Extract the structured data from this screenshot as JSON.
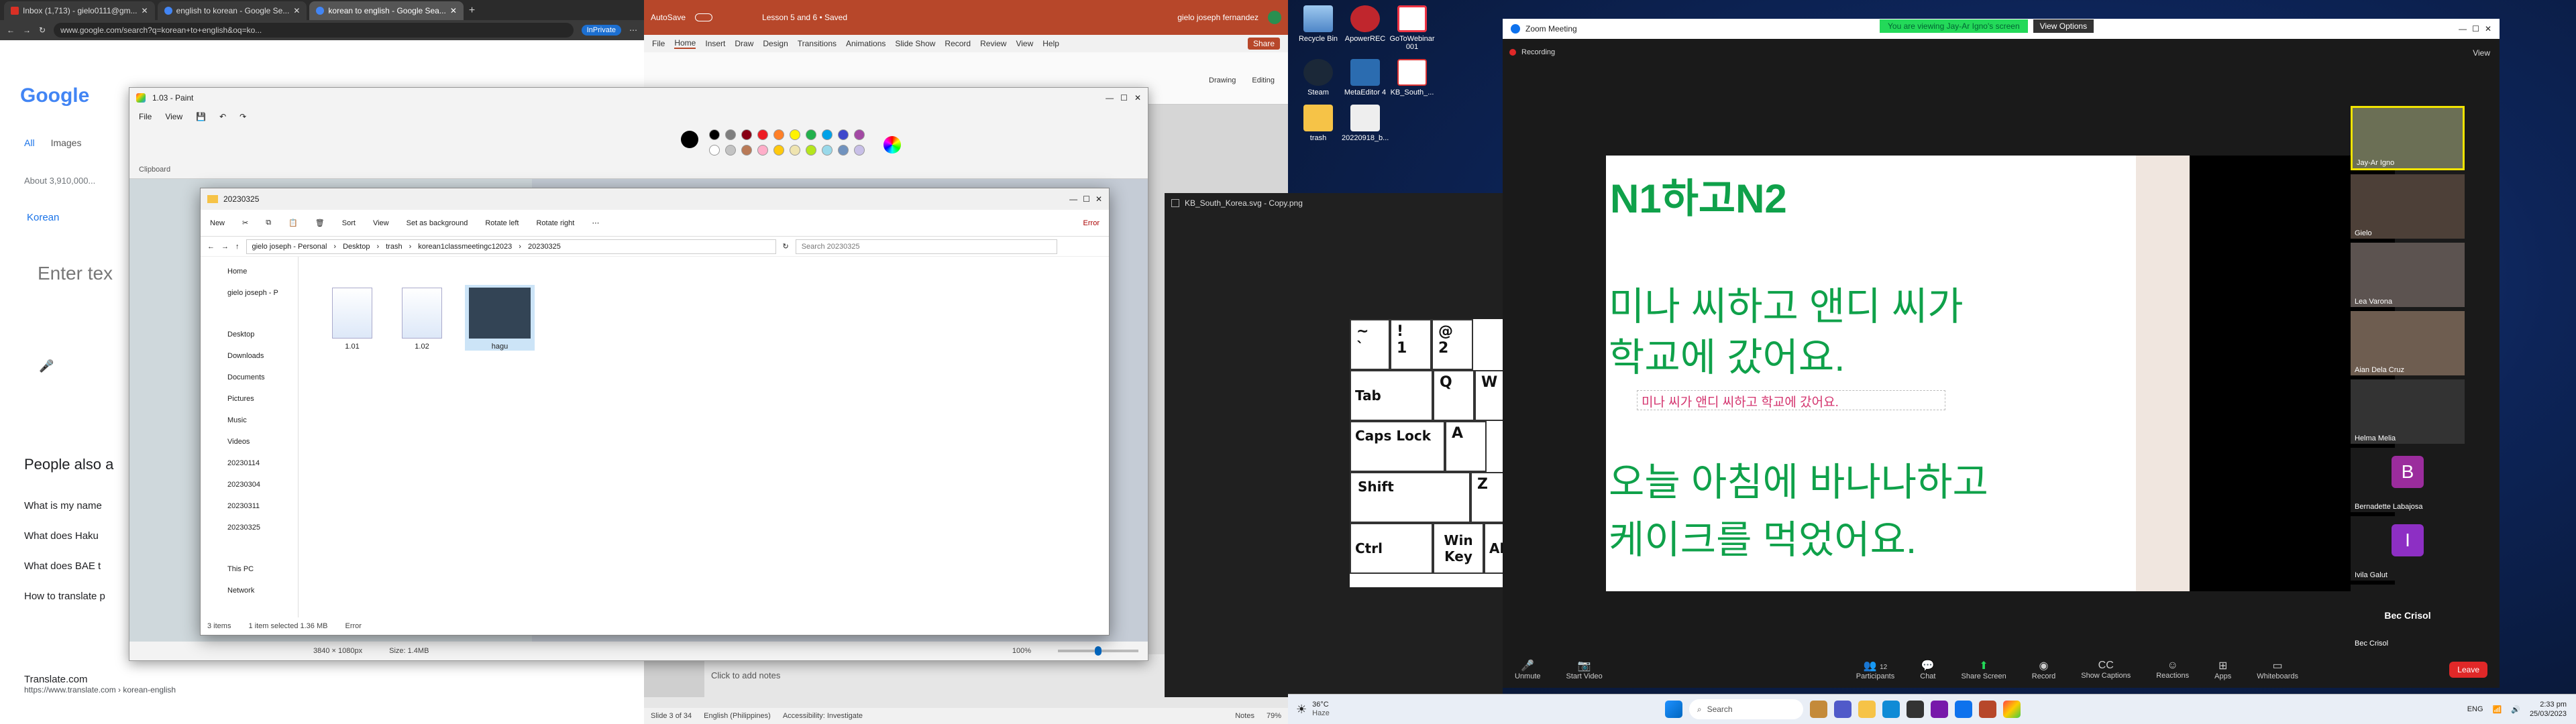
{
  "chrome": {
    "tabs": [
      {
        "label": "Inbox (1,713) - gielo0111@gm..."
      },
      {
        "label": "english to korean - Google Se..."
      },
      {
        "label": "korean to english - Google Sea..."
      }
    ],
    "url": "www.google.com/search?q=korean+to+english&oq=ko...",
    "private_label": "InPrivate",
    "logo": "Google",
    "search_tabs": [
      "All",
      "Images"
    ],
    "results_count": "About 3,910,000...",
    "source_lang": "Korean",
    "enter_text": "Enter tex",
    "people_also_ask": "People also a",
    "questions": [
      "What is my name",
      "What does Haku",
      "What does BAE t",
      "How to translate p"
    ],
    "result_site": "Translate.com",
    "result_url": "https://www.translate.com › korean-english"
  },
  "paint": {
    "title": "1.03 - Paint",
    "menu": [
      "File",
      "View"
    ],
    "clipboard_label": "Clipboard",
    "status_size": "3840 × 1080px",
    "status_filesize": "Size: 1.4MB",
    "zoom": "100%",
    "colors": [
      "#000000",
      "#7f7f7f",
      "#880015",
      "#ed1c24",
      "#ff7f27",
      "#fff200",
      "#22b14c",
      "#00a2e8",
      "#3f48cc",
      "#a349a4",
      "#ffffff",
      "#c3c3c3",
      "#b97a57",
      "#ffaec9",
      "#ffc90e",
      "#efe4b0",
      "#b5e61d",
      "#99d9ea",
      "#7092be",
      "#c8bfe7"
    ]
  },
  "explorer": {
    "title": "20230325",
    "new_label": "New",
    "sort_label": "Sort",
    "view_label": "View",
    "set_bg_label": "Set as background",
    "rotate_left_label": "Rotate left",
    "rotate_right_label": "Rotate right",
    "error_label": "Error",
    "breadcrumb": [
      "gielo joseph - Personal",
      "Desktop",
      "trash",
      "korean1classmeetingc12023",
      "20230325"
    ],
    "search_placeholder": "Search 20230325",
    "nav": [
      "Home",
      "gielo joseph - P",
      "Desktop",
      "Downloads",
      "Documents",
      "Pictures",
      "Music",
      "Videos",
      "20230114",
      "20230304",
      "20230311",
      "20230325",
      "This PC",
      "Network"
    ],
    "files": [
      {
        "name": "1.01"
      },
      {
        "name": "1.02"
      },
      {
        "name": "hagu"
      }
    ],
    "status_items": "3 items",
    "status_selected": "1 item selected  1.36 MB",
    "status_error": "Error"
  },
  "ppt": {
    "autosave": "AutoSave",
    "doc_title": "Lesson 5 and 6 • Saved",
    "user": "gielo joseph fernandez",
    "share": "Share",
    "menu": [
      "File",
      "Home",
      "Insert",
      "Draw",
      "Design",
      "Transitions",
      "Animations",
      "Slide Show",
      "Record",
      "Review",
      "View",
      "Help"
    ],
    "drawing_label": "Drawing",
    "editing_label": "Editing",
    "notes_placeholder": "Click to add notes",
    "status_slide": "Slide 3 of 34",
    "status_lang": "English (Philippines)",
    "status_access": "Accessibility: Investigate",
    "status_notes": "Notes",
    "status_zoom": "79%"
  },
  "image_viewer": {
    "title": "KB_South_Korea.svg - Copy.png"
  },
  "keyboard": {
    "keys": [
      "~\n`",
      "!\n1",
      "@\n2",
      "Tab",
      "Q",
      "W",
      "Caps Lock",
      "A",
      "Shift",
      "Z",
      "Ctrl",
      "Win\nKey",
      "Alt"
    ]
  },
  "desktop": {
    "icons": [
      "Recycle Bin",
      "ApowerREC",
      "GoToWebinar 001",
      "Steam",
      "MetaEditor 4",
      "KB_South_...",
      "trash",
      "20220918_b..."
    ]
  },
  "zoom": {
    "title": "Zoom Meeting",
    "banner": "You are viewing Jay-Ar Igno's screen",
    "view_options": "View Options",
    "recording": "Recording",
    "view_label": "View",
    "slide": {
      "heading": "N1하고N2",
      "line1": "미나 씨하고 앤디 씨가",
      "line2": "학교에 갔어요.",
      "typed": "미나 씨가 앤디 씨하고 학교에 갔어요.",
      "line3": "오늘 아침에 바나나하고",
      "line4": "케이크를 먹었어요."
    },
    "participants": [
      {
        "name": "Jay-Ar Igno"
      },
      {
        "name": "Gielo"
      },
      {
        "name": "Lea Varona"
      },
      {
        "name": "Aian Dela Cruz"
      },
      {
        "name": "Helma Melia"
      },
      {
        "name": "Bernadette Labajosa",
        "initial": "B"
      },
      {
        "name": "Ivila Galut",
        "initial": "I"
      },
      {
        "name": "Bec Crisol",
        "initial": "Bec Crisol"
      }
    ],
    "controls": [
      "Unmute",
      "Start Video",
      "Participants",
      "Chat",
      "Share Screen",
      "Record",
      "Show Captions",
      "Reactions",
      "Apps",
      "Whiteboards"
    ],
    "participant_count": "12",
    "leave": "Leave"
  },
  "taskbar": {
    "weather_temp": "36°C",
    "weather_desc": "Haze",
    "search": "Search",
    "lang": "ENG",
    "time": "2:33 pm",
    "date": "25/03/2023"
  },
  "colors": {
    "zoom_green": "#0fa14a",
    "zoom_blue": "#0e72ed",
    "leave_red": "#e02828",
    "banner_green": "#23d959"
  }
}
